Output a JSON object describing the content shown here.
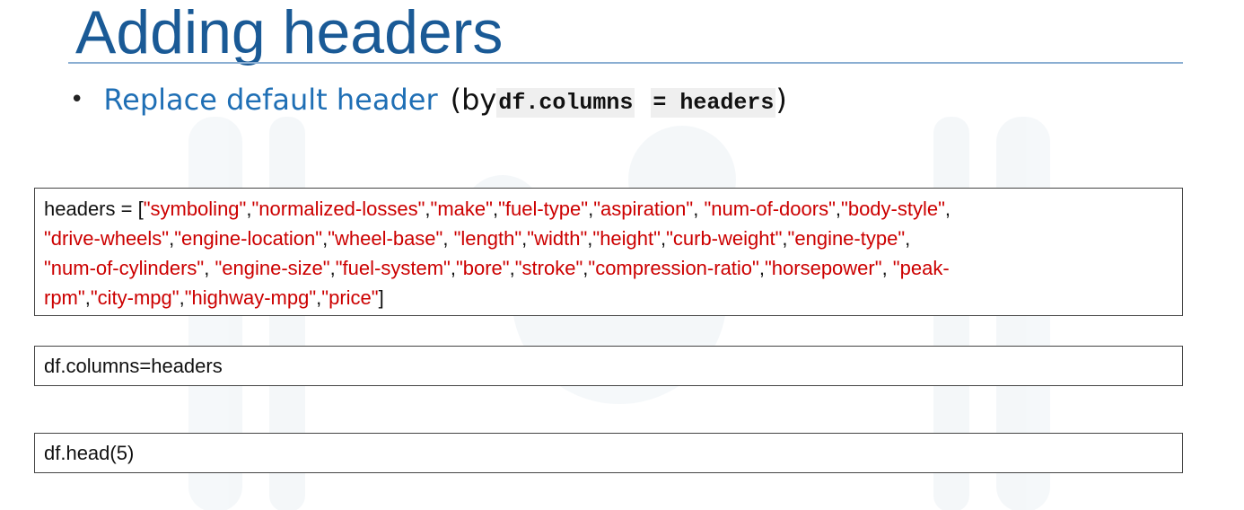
{
  "slide": {
    "title": "Adding headers"
  },
  "bullet": {
    "main_text": "Replace default header",
    "open_paren": "(by ",
    "code_part1": "df.columns",
    "code_part2": "= headers",
    "close_paren": ")"
  },
  "code_boxes": {
    "headers_assignment": {
      "prefix": "headers = [",
      "items": [
        "\"symboling\"",
        "\"normalized-losses\"",
        "\"make\"",
        "\"fuel-type\"",
        "\"aspiration\"",
        "\"num-of-doors\"",
        "\"body-style\"",
        "\"drive-wheels\"",
        "\"engine-location\"",
        "\"wheel-base\"",
        "\"length\"",
        "\"width\"",
        "\"height\"",
        "\"curb-weight\"",
        "\"engine-type\"",
        "\"num-of-cylinders\"",
        "\"engine-size\"",
        "\"fuel-system\"",
        "\"bore\"",
        "\"stroke\"",
        "\"compression-ratio\"",
        "\"horsepower\"",
        "\"peak-rpm\"",
        "\"city-mpg\"",
        "\"highway-mpg\"",
        "\"price\""
      ],
      "suffix": "]"
    },
    "columns_line": "df.columns=headers",
    "head_line": "df.head(5)"
  },
  "colors": {
    "title": "#1a5a96",
    "bullet_text": "#1f6fb5",
    "string_literal": "#cc0000",
    "rule": "#8aaed2"
  }
}
